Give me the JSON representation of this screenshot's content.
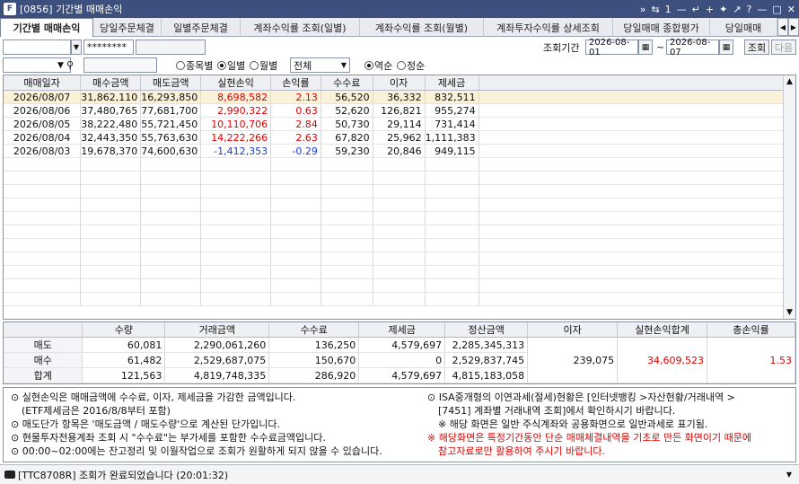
{
  "window": {
    "title": "[0856] 기간별 매매손익",
    "controls": [
      "»",
      "⇆",
      "1",
      "—",
      "↵",
      "+",
      "✦",
      "↗",
      "?",
      "—",
      "□",
      "✕"
    ]
  },
  "tabs": [
    "기간별 매매손익",
    "당일주문체결",
    "일별주문체결",
    "계좌수익률 조회(일별)",
    "계좌수익률 조회(월별)",
    "계좌투자수익률 상세조회",
    "당일매매 종합평가",
    "당일매매"
  ],
  "account": {
    "password": "********",
    "period_label": "조회기간",
    "start_date": "2026-08-01",
    "tilde": "~",
    "end_date": "2026-08-07",
    "query_button": "조회",
    "next_button": "다음"
  },
  "filters": {
    "radio_by_stock": "종목별",
    "radio_daily": "일별",
    "radio_monthly": "월별",
    "select_value": "전체",
    "radio_desc": "역순",
    "radio_asc": "정순"
  },
  "grid": {
    "headers": [
      "매매일자",
      "매수금액",
      "매도금액",
      "실현손익",
      "손익률",
      "수수료",
      "이자",
      "제세금"
    ],
    "rows": [
      [
        "2026/08/07",
        "31,862,110",
        "16,293,850",
        "8,698,582",
        "2.13",
        "56,520",
        "36,332",
        "832,511"
      ],
      [
        "2026/08/06",
        "37,480,765",
        "77,681,700",
        "2,990,322",
        "0.63",
        "52,620",
        "126,821",
        "955,274"
      ],
      [
        "2026/08/05",
        "38,222,480",
        "55,721,450",
        "10,110,706",
        "2.84",
        "50,730",
        "29,114",
        "731,414"
      ],
      [
        "2026/08/04",
        "32,443,350",
        "55,763,630",
        "14,222,266",
        "2.63",
        "67,820",
        "25,962",
        "1,111,383"
      ],
      [
        "2026/08/03",
        "19,678,370",
        "74,600,630",
        "-1,412,353",
        "-0.29",
        "59,230",
        "20,846",
        "949,115"
      ]
    ],
    "row_colors": [
      "red",
      "red",
      "red",
      "red",
      "blue"
    ]
  },
  "summary": {
    "headers": [
      "",
      "수량",
      "거래금액",
      "수수료",
      "제세금",
      "정산금액",
      "이자",
      "실현손익합계",
      "총손익률"
    ],
    "rows": [
      {
        "label": "매도",
        "qty": "60,081",
        "amount": "2,290,061,260",
        "fee": "136,250",
        "tax": "4,579,697",
        "settle": "2,285,345,313"
      },
      {
        "label": "매수",
        "qty": "61,482",
        "amount": "2,529,687,075",
        "fee": "150,670",
        "tax": "0",
        "settle": "2,529,837,745"
      },
      {
        "label": "합계",
        "qty": "121,563",
        "amount": "4,819,748,335",
        "fee": "286,920",
        "tax": "4,579,697",
        "settle": "4,815,183,058"
      }
    ],
    "interest": "239,075",
    "realized_total": "34,609,523",
    "total_return": "1.53"
  },
  "notes": {
    "left": [
      "⊙ 실현손익은 매매금액에 수수료, 이자, 제세금을 가감한 금액입니다.",
      "(ETF제세금은 2016/8/8부터 포함)",
      "⊙ 매도단가 항목은 '매도금액 / 매도수량'으로 계산된 단가입니다.",
      "⊙ 현물투자전용계좌 조회 시 \"수수료\"는 부가세를 포함한 수수료금액입니다.",
      "⊙ 00:00~02:00에는 잔고정리 및 이월작업으로 조회가 원활하게 되지 않을 수 있습니다."
    ],
    "right": [
      "⊙ ISA중개형의 이연과세(절세)현황은 [인터넷뱅킹 >자산현황/거래내역 >",
      "[7451] 계좌별 거래내역 조회]에서 확인하시기 바랍니다.",
      "※ 해당 화면은 일반 주식계좌와 공용화면으로 일반과세로 표기됨.",
      "※ 해당화면은 특정기간동안 단순 매매체결내역을 기초로 만든 화면이기 때문에",
      "참고자료로만 활용하여 주시기 바랍니다."
    ]
  },
  "status": {
    "message": "[TTC8708R] 조회가 완료되었습니다 (20:01:32)"
  }
}
